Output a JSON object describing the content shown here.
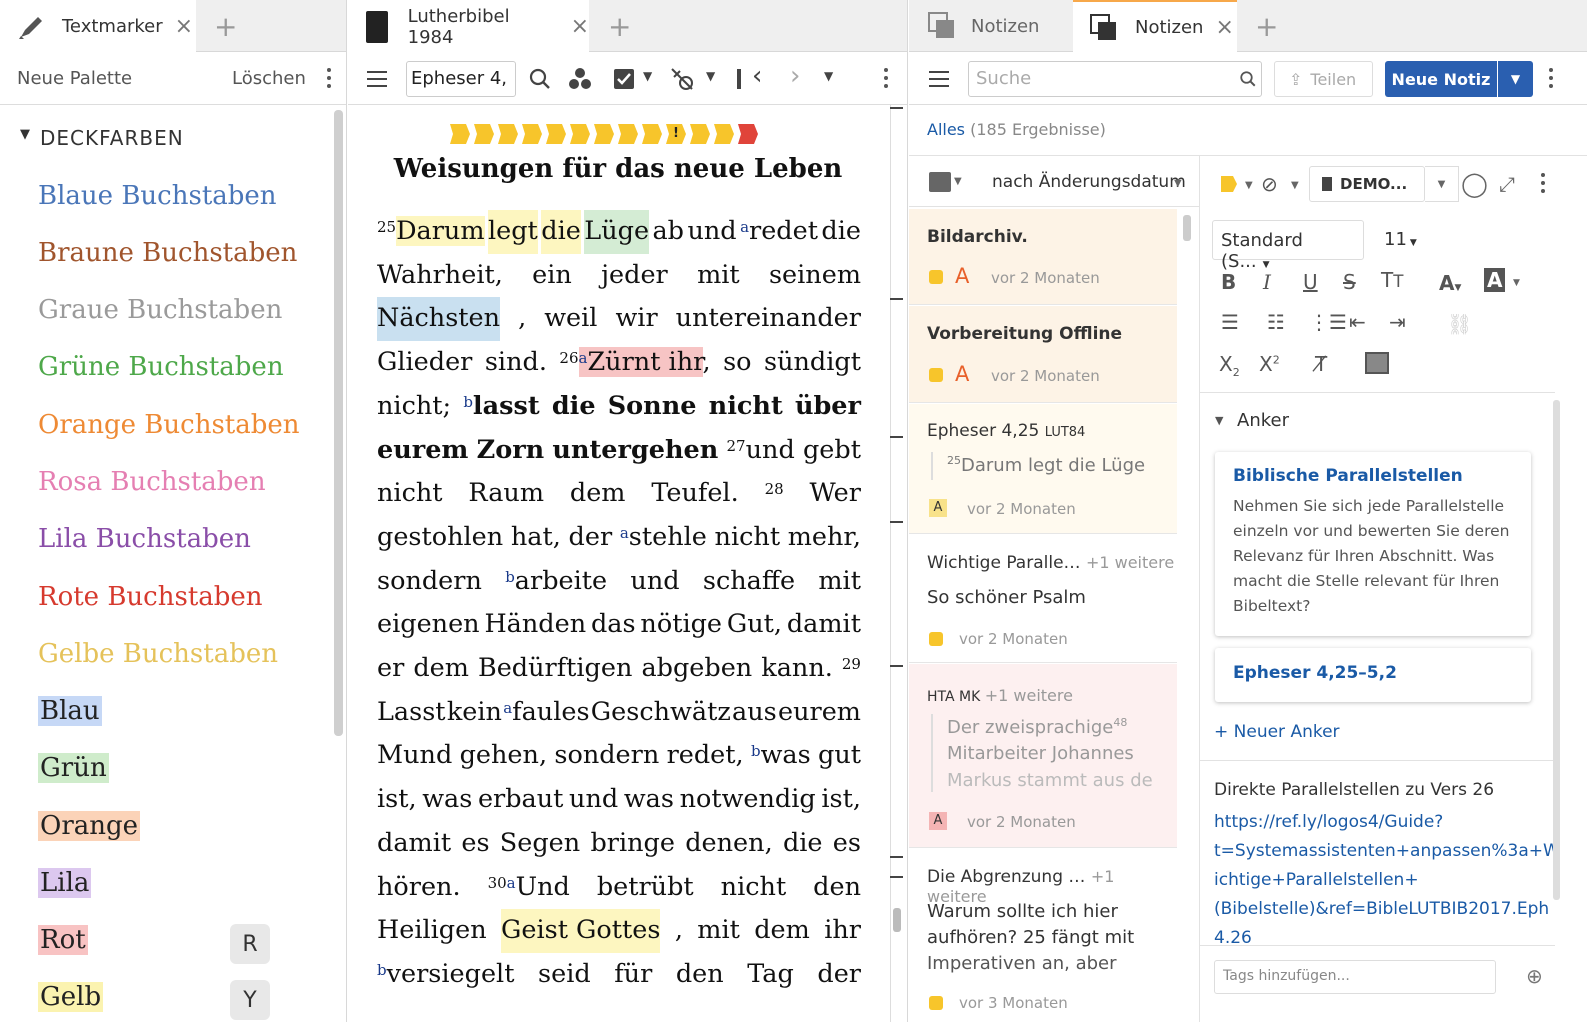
{
  "panel1": {
    "tab_title": "Textmarker",
    "toolbar": {
      "new_palette": "Neue Palette",
      "delete": "Löschen"
    },
    "section_title": "DECKFARBEN",
    "text_styles": [
      {
        "label": "Blaue Buchstaben",
        "color": "#4a76b8"
      },
      {
        "label": "Braune Buchstaben",
        "color": "#a0552d"
      },
      {
        "label": "Graue Buchstaben",
        "color": "#9a9a9a"
      },
      {
        "label": "Grüne Buchstaben",
        "color": "#4ea84a"
      },
      {
        "label": "Orange Buchstaben",
        "color": "#ee8a34"
      },
      {
        "label": "Rosa Buchstaben",
        "color": "#e57fb2"
      },
      {
        "label": "Lila Buchstaben",
        "color": "#8a4ea8"
      },
      {
        "label": "Rote Buchstaben",
        "color": "#d63a2e"
      },
      {
        "label": "Gelbe Buchstaben",
        "color": "#e5c25a"
      }
    ],
    "swatches": [
      {
        "label": "Blau",
        "color": "#c6d8f6",
        "key": ""
      },
      {
        "label": "Grün",
        "color": "#cfeccb",
        "key": ""
      },
      {
        "label": "Orange",
        "color": "#fbd3b8",
        "key": ""
      },
      {
        "label": "Lila",
        "color": "#dcc8ef",
        "key": ""
      },
      {
        "label": "Rot",
        "color": "#f8c3c3",
        "key": "R"
      },
      {
        "label": "Gelb",
        "color": "#fbf3b0",
        "key": "Y"
      }
    ]
  },
  "panel2": {
    "tab_title": "Lutherbibel 1984",
    "reference": "Epheser 4,",
    "heading": "Weisungen für das neue Leben"
  },
  "panel3": {
    "tabs": [
      "Notizen",
      "Notizen"
    ],
    "search_placeholder": "Suche",
    "share": "Teilen",
    "new_note": "Neue Notiz",
    "filter_all": "Alles",
    "result_count": "(185 Ergebnisse)",
    "sort": "nach Änderungsdatum",
    "notes": [
      {
        "title": "Bildarchiv.",
        "time": "vor 2 Monaten"
      },
      {
        "title": "Vorbereitung Offline",
        "time": "vor 2 Monaten"
      },
      {
        "title": "Epheser 4,25",
        "tag": "LUT84",
        "quote": "Darum legt die Lüge",
        "verse": "25",
        "time": "vor 2 Monaten"
      },
      {
        "title": "Wichtige Paralle…",
        "more": "+1 weitere",
        "body": "So schöner Psalm",
        "time": "vor 2 Monaten"
      },
      {
        "title": "HTA MK",
        "more": "+1 weitere",
        "quote": "Der zweisprachige",
        "sup": "48",
        "quote2": "Mitarbeiter Johannes",
        "quote3": "Markus stammt aus de",
        "time": "vor 2 Monaten"
      },
      {
        "title": "Die Abgrenzung …",
        "more": "+1 weitere",
        "body": "Warum sollte ich hier",
        "body2": "aufhören? 25 fängt mit",
        "body3": "Imperativen an, aber",
        "time": "vor 3 Monaten"
      }
    ],
    "editor": {
      "notebook": "DEMO...",
      "style": "Standard (S...",
      "size": "11",
      "anchor_title": "Anker",
      "anchor1_title": "Biblische Parallelstellen",
      "anchor1_text": "Nehmen Sie sich jede Parallelstelle einzeln vor und bewerten Sie deren Relevanz für Ihren Abschnitt. Was macht die Stelle relevant für Ihren Bibeltext?",
      "anchor2_title": "Epheser 4,25–5,2",
      "new_anchor": "+ Neuer Anker",
      "direct": "Direkte Parallelstellen zu Vers 26",
      "url": "https://ref.ly/logos4/Guide?t=Systemassistenten+anpassen%3a+Wichtige+Parallelstellen+(Bibelstelle)&ref=BibleLUTBIB2017.Eph4.26",
      "url_lines": [
        "https://ref.ly/logos4/Guide?",
        "t=Systemassistenten+anpassen%3a+W",
        "ichtige+Parallelstellen+",
        "(Bibelstelle)&ref=BibleLUTBIB2017.Eph",
        "4.26"
      ],
      "tags_placeholder": "Tags hinzufügen..."
    }
  }
}
